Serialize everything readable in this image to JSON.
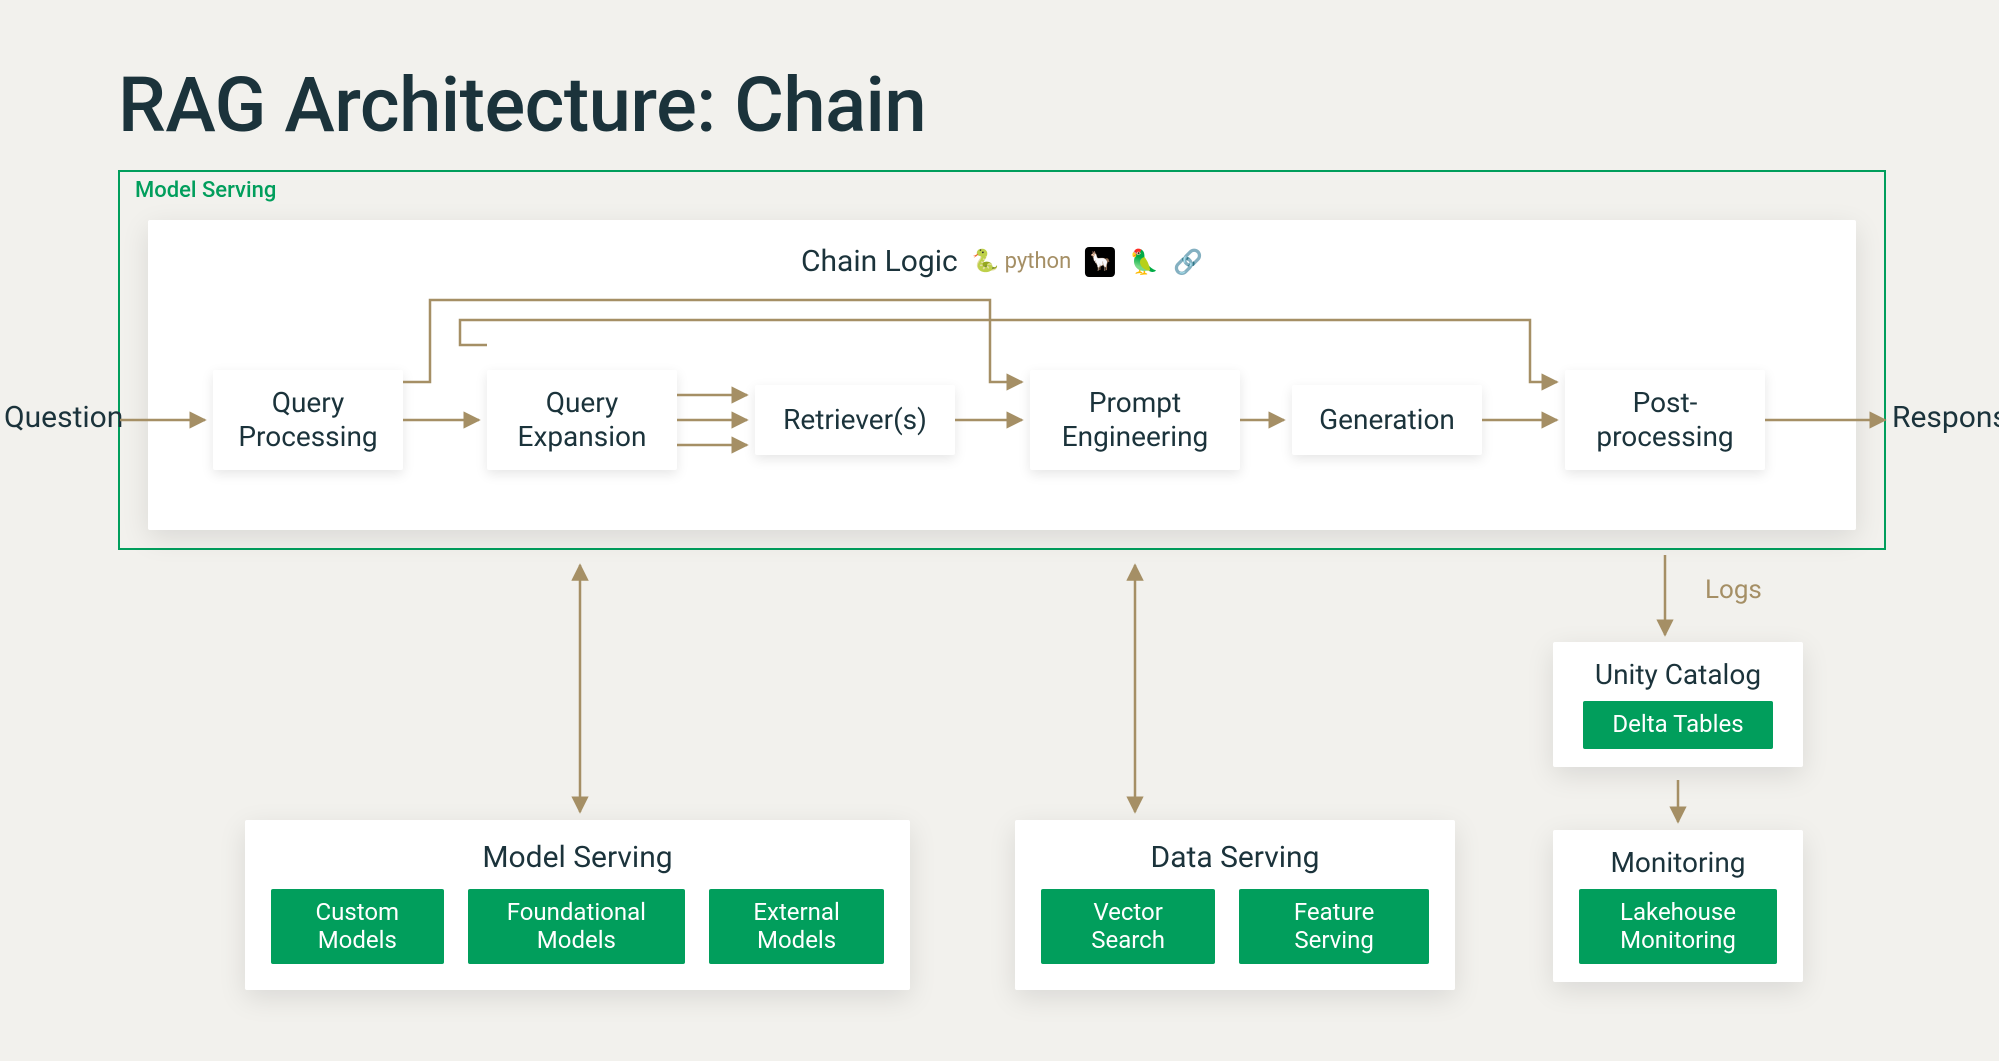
{
  "title": "RAG Architecture: Chain",
  "model_serving_outer_label": "Model Serving",
  "chain_logic_label": "Chain Logic",
  "chain_logic_icons": {
    "python": "🐍 python",
    "llama": "🦙",
    "parrot": "🦜",
    "link": "🔗"
  },
  "edge_labels": {
    "question": "Question",
    "response": "Response",
    "logs": "Logs"
  },
  "stages": {
    "query_processing": "Query Processing",
    "query_expansion": "Query Expansion",
    "retrievers": "Retriever(s)",
    "prompt_engineering": "Prompt Engineering",
    "generation": "Generation",
    "post_processing": "Post-processing"
  },
  "panels": {
    "model_serving": {
      "title": "Model Serving",
      "items": [
        "Custom Models",
        "Foundational Models",
        "External Models"
      ]
    },
    "data_serving": {
      "title": "Data Serving",
      "items": [
        "Vector Search",
        "Feature Serving"
      ]
    },
    "unity_catalog": {
      "title": "Unity Catalog",
      "items": [
        "Delta Tables"
      ]
    },
    "monitoring": {
      "title": "Monitoring",
      "items": [
        "Lakehouse Monitoring"
      ]
    }
  },
  "colors": {
    "bg": "#f2f1ed",
    "text": "#1b333b",
    "accent_green": "#019e5c",
    "arrow": "#a58f65"
  }
}
